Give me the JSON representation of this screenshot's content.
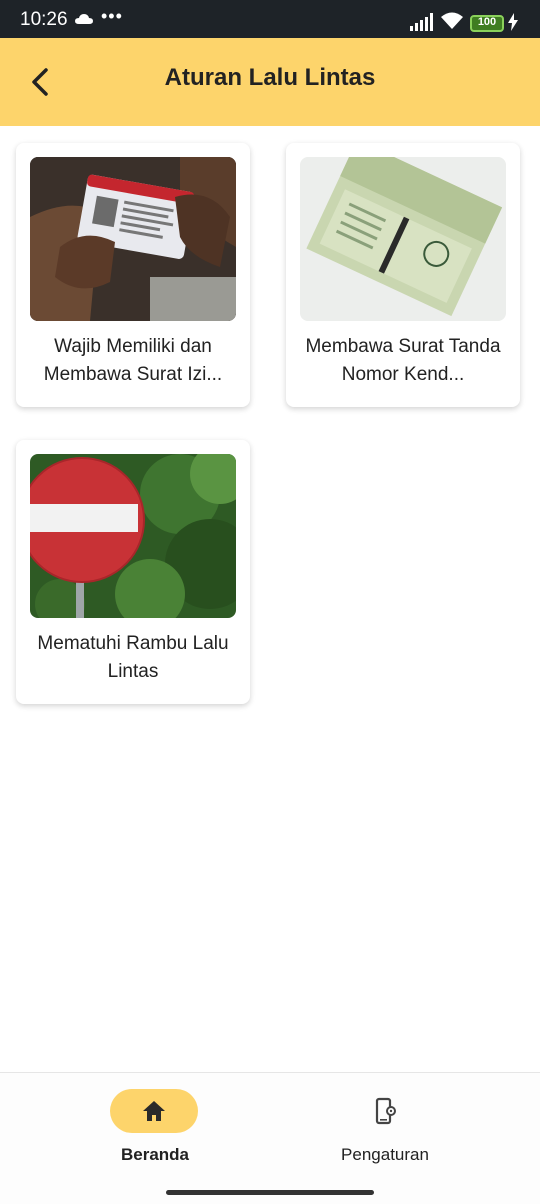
{
  "status_bar": {
    "time": "10:26",
    "dots": "•••",
    "battery": "100",
    "icons": [
      "cloud-icon",
      "signal-icon",
      "wifi-icon",
      "battery-icon",
      "charging-bolt-icon"
    ]
  },
  "app_bar": {
    "title": "Aturan Lalu Lintas",
    "back_icon": "chevron-left-icon",
    "background": "#fdd46b"
  },
  "cards": [
    {
      "title": "Wajib Memiliki dan Membawa Surat Izi...",
      "image": "driving-license-photo"
    },
    {
      "title": "Membawa Surat Tanda Nomor Kend...",
      "image": "stnk-document-photo"
    },
    {
      "title": "Mematuhi Rambu Lalu Lintas",
      "image": "no-entry-sign-photo"
    }
  ],
  "bottom_nav": {
    "items": [
      {
        "label": "Beranda",
        "icon": "home-icon",
        "active": true
      },
      {
        "label": "Pengaturan",
        "icon": "phone-settings-icon",
        "active": false
      }
    ],
    "accent": "#fdd46b"
  }
}
